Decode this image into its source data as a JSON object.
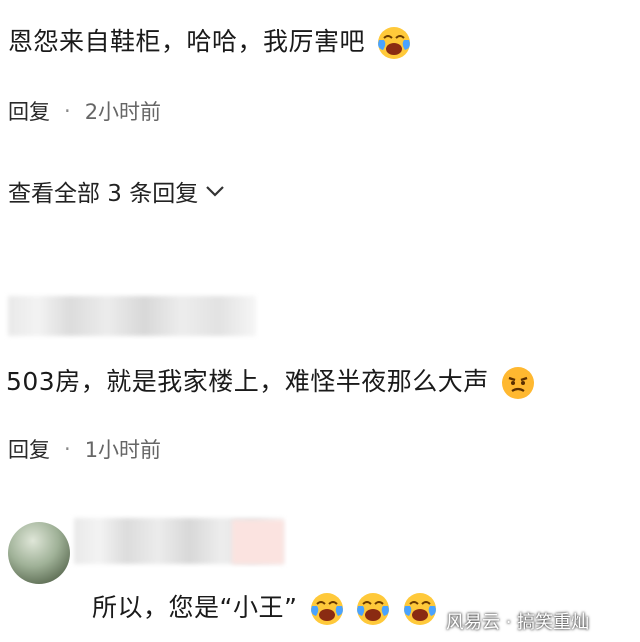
{
  "comment1": {
    "text": "恩怨来自鞋柜，哈哈，我厉害吧",
    "reply_label": "回复",
    "separator": "·",
    "time": "2小时前",
    "view_all": "查看全部 3 条回复"
  },
  "comment2": {
    "text": "503房，就是我家楼上，难怪半夜那么大声",
    "reply_label": "回复",
    "separator": "·",
    "time": "1小时前"
  },
  "comment3": {
    "text": "所以，您是“小王”"
  },
  "watermark": {
    "text": "风易云 · 搞笑重灿"
  },
  "icons": {
    "laugh_cry": "laugh-cry-emoji",
    "angry": "angry-emoji",
    "chevron": "chevron-down-icon"
  }
}
